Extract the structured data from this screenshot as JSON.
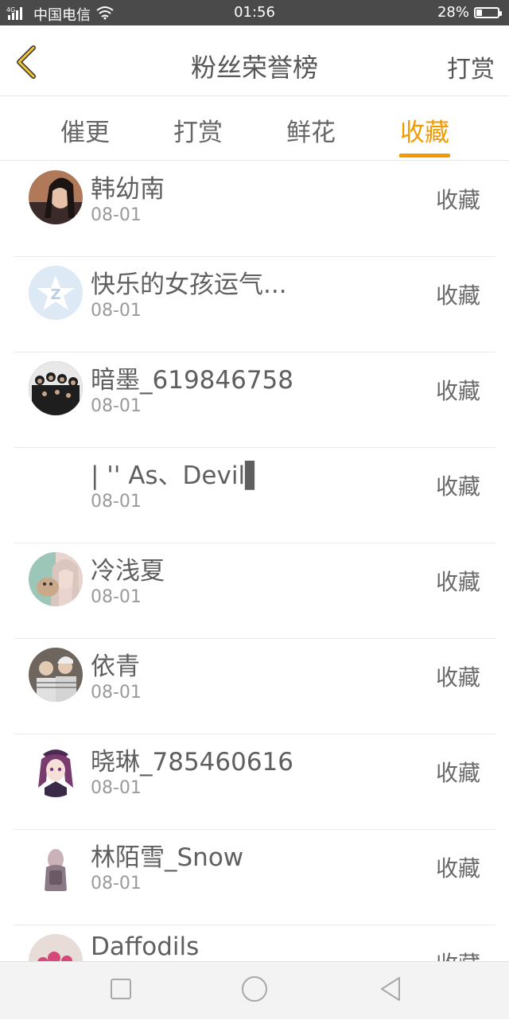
{
  "status": {
    "carrier_signal": "4G",
    "carrier_name": "中国电信",
    "time": "01:56",
    "battery": "28%",
    "battery_level": 0.28
  },
  "header": {
    "title": "粉丝荣誉榜",
    "right_button": "打赏"
  },
  "tabs": {
    "items": [
      {
        "label": "催更",
        "active": false
      },
      {
        "label": "打赏",
        "active": false
      },
      {
        "label": "鲜花",
        "active": false
      },
      {
        "label": "收藏",
        "active": true
      }
    ]
  },
  "list": {
    "items": [
      {
        "name": "韩幼南",
        "date": "08-01",
        "action": "收藏",
        "avatar": "girl-portrait"
      },
      {
        "name": "快乐的女孩运气...",
        "date": "08-01",
        "action": "收藏",
        "avatar": "qq-default"
      },
      {
        "name": "暗墨_619846758",
        "date": "08-01",
        "action": "收藏",
        "avatar": "group-photo"
      },
      {
        "name": "| '' As、Devil▌",
        "date": "08-01",
        "action": "收藏",
        "avatar": "none"
      },
      {
        "name": "冷浅夏",
        "date": "08-01",
        "action": "收藏",
        "avatar": "girl-with-cat"
      },
      {
        "name": "依青",
        "date": "08-01",
        "action": "收藏",
        "avatar": "couple-photo"
      },
      {
        "name": "晓琳_785460616",
        "date": "08-01",
        "action": "收藏",
        "avatar": "anime-girl"
      },
      {
        "name": "林陌雪_Snow",
        "date": "08-01",
        "action": "收藏",
        "avatar": "girl-back-view"
      },
      {
        "name": "Daffodils",
        "date": "",
        "action": "收藏",
        "avatar": "flowers"
      }
    ]
  },
  "navbar": {
    "buttons": [
      "recents",
      "home",
      "back"
    ]
  }
}
